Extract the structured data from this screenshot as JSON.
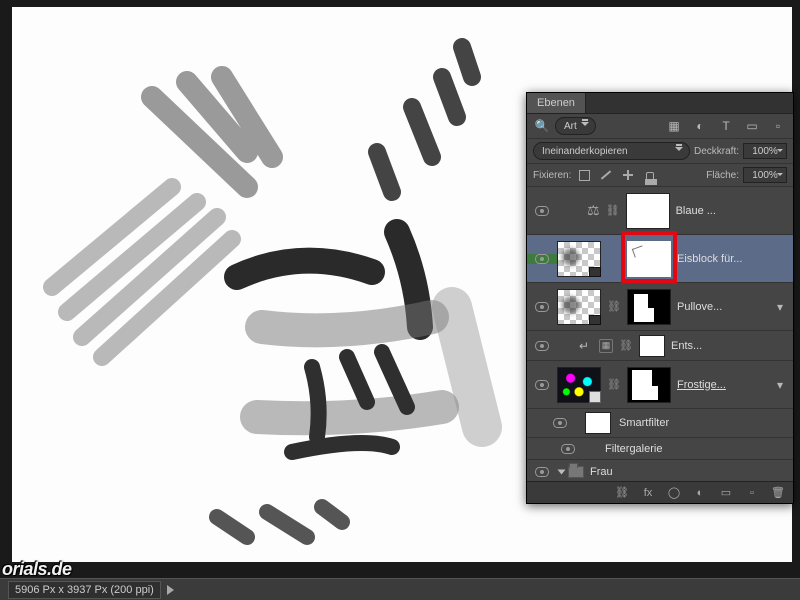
{
  "watermark": "orials.de",
  "status": {
    "dimensions": "5906 Px x 3937 Px (200 ppi)"
  },
  "panel": {
    "tab_label": "Ebenen",
    "filter_dropdown": "Art",
    "blend_mode": "Ineinanderkopieren",
    "opacity_label": "Deckkraft:",
    "opacity_value": "100%",
    "lock_label": "Fixieren:",
    "fill_label": "Fläche:",
    "fill_value": "100%",
    "layers": [
      {
        "name": "Blaue ...",
        "type": "adjustment"
      },
      {
        "name": "Eisblock für...",
        "type": "masked",
        "selected": true
      },
      {
        "name": "Pullove...",
        "type": "masked_fx"
      },
      {
        "name": "Ents...",
        "type": "clipped_white"
      },
      {
        "name": "Frostige...",
        "type": "smartobject"
      }
    ],
    "smartfilter_label": "Smartfilter",
    "filter_item": "Filtergalerie",
    "folder_name": "Frau",
    "fx_label": "fx"
  }
}
